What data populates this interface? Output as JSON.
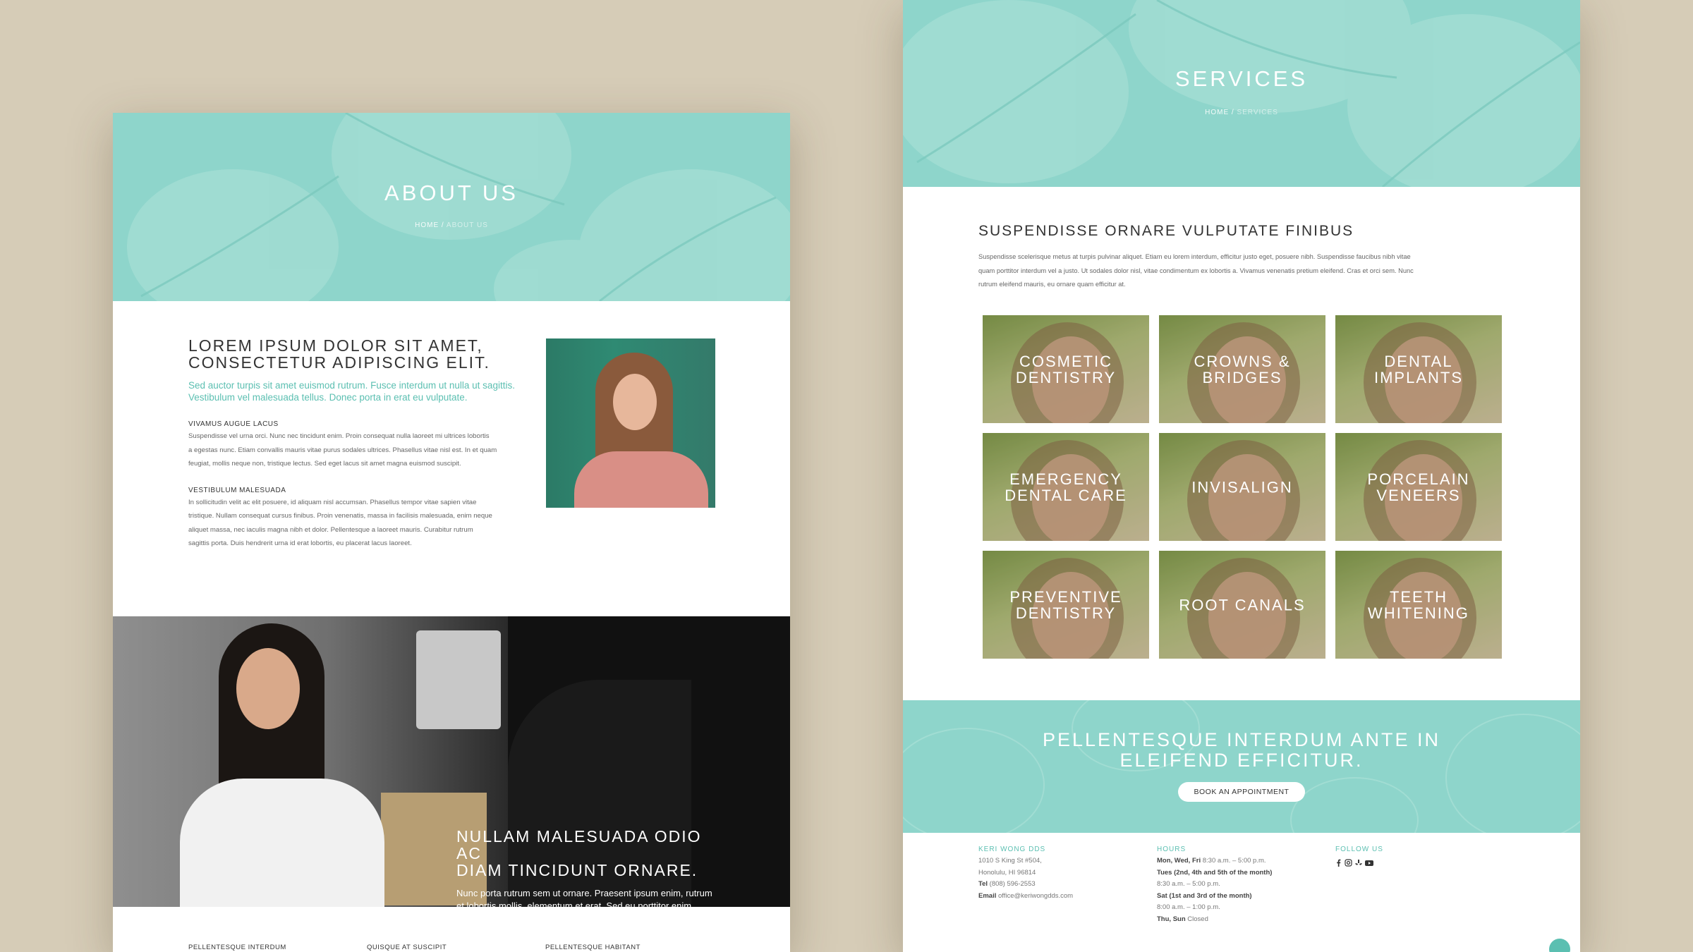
{
  "about": {
    "hero_title": "ABOUT US",
    "crumb_home": "HOME",
    "crumb_sep": "/",
    "crumb_current": "ABOUT US",
    "heading_line1": "LOREM IPSUM DOLOR SIT AMET,",
    "heading_line2": "CONSECTETUR ADIPISCING ELIT.",
    "lead": "Sed auctor turpis sit amet euismod rutrum. Fusce interdum ut nulla ut sagittis. Vestibulum vel malesuada tellus. Donec porta in erat eu vulputate.",
    "sub1": "VIVAMUS AUGUE LACUS",
    "para1_lines": [
      "Suspendisse vel urna orci. Nunc nec tincidunt enim. Proin consequat nulla laoreet mi ultrices lobortis",
      "a egestas nunc. Etiam convallis mauris vitae purus sodales ultrices. Phasellus vitae nisl est. In et quam",
      "feugiat, mollis neque non, tristique lectus. Sed eget lacus sit amet magna euismod suscipit."
    ],
    "sub2": "VESTIBULUM MALESUADA",
    "para2_lines": [
      "In sollicitudin velit ac elit posuere, id aliquam nisl accumsan. Phasellus tempor vitae sapien vitae",
      "tristique. Nullam consequat cursus finibus. Proin venenatis, massa in facilisis malesuada, enim neque",
      "aliquet massa, nec iaculis magna nibh et dolor. Pellentesque a laoreet mauris. Curabitur rutrum",
      "sagittis porta. Duis hendrerit urna id erat lobortis, eu placerat lacus laoreet."
    ],
    "band_heading_line1": "NULLAM MALESUADA ODIO AC",
    "band_heading_line2": "DIAM TINCIDUNT ORNARE.",
    "band_text": "Nunc porta rutrum sem ut ornare. Praesent ipsum enim, rutrum et lobortis mollis, elementum et erat. Sed eu porttitor enim. Pellentesque sodales erat eu lorem porta egestas.",
    "footer_cols": [
      "PELLENTESQUE INTERDUM",
      "QUISQUE AT SUSCIPIT",
      "PELLENTESQUE HABITANT"
    ]
  },
  "services": {
    "hero_title": "SERVICES",
    "crumb_home": "HOME",
    "crumb_sep": "/",
    "crumb_current": "SERVICES",
    "heading": "SUSPENDISSE ORNARE VULPUTATE FINIBUS",
    "intro_lines": [
      "Suspendisse scelerisque metus at turpis pulvinar aliquet. Etiam eu lorem interdum, efficitur justo eget, posuere nibh. Suspendisse faucibus nibh vitae",
      "quam porttitor interdum vel a justo. Ut sodales dolor nisl, vitae condimentum ex lobortis a. Vivamus venenatis pretium eleifend. Cras et orci sem. Nunc",
      "rutrum eleifend mauris, eu ornare quam efficitur at."
    ],
    "tiles": [
      {
        "line1": "COSMETIC",
        "line2": "DENTISTRY"
      },
      {
        "line1": "CROWNS &",
        "line2": "BRIDGES"
      },
      {
        "line1": "DENTAL",
        "line2": "IMPLANTS"
      },
      {
        "line1": "EMERGENCY",
        "line2": "DENTAL CARE"
      },
      {
        "line1": "INVISALIGN",
        "line2": ""
      },
      {
        "line1": "PORCELAIN",
        "line2": "VENEERS"
      },
      {
        "line1": "PREVENTIVE",
        "line2": "DENTISTRY"
      },
      {
        "line1": "ROOT CANALS",
        "line2": ""
      },
      {
        "line1": "TEETH",
        "line2": "WHITENING"
      }
    ],
    "cta_line1": "PELLENTESQUE INTERDUM ANTE IN",
    "cta_line2": "ELEIFEND EFFICITUR.",
    "cta_button": "BOOK AN APPOINTMENT",
    "footer": {
      "col1_title": "KERI WONG DDS",
      "address1": "1010 S King St #504,",
      "address2": "Honolulu, HI 96814",
      "tel_label": "Tel",
      "tel": "(808) 596-2553",
      "email_label": "Email",
      "email": "office@keriwongdds.com",
      "col2_title": "HOURS",
      "h1_days": "Mon, Wed, Fri",
      "h1_time": "8:30 a.m. – 5:00 p.m.",
      "h2_days": "Tues (2nd, 4th and 5th of the month)",
      "h2_time": "8:30 a.m. – 5:00 p.m.",
      "h3_days": "Sat (1st and 3rd of the month)",
      "h3_time": "8:00 a.m. – 1:00 p.m.",
      "h4_days": "Thu, Sun",
      "h4_time": "Closed",
      "col3_title": "FOLLOW US",
      "social_icons": [
        "facebook-icon",
        "instagram-icon",
        "yelp-icon",
        "youtube-icon"
      ]
    }
  },
  "colors": {
    "mint": "#8ed5cb",
    "mint_text": "#5bbfb1",
    "backdrop": "#d6ccb7",
    "dark": "#111111"
  }
}
